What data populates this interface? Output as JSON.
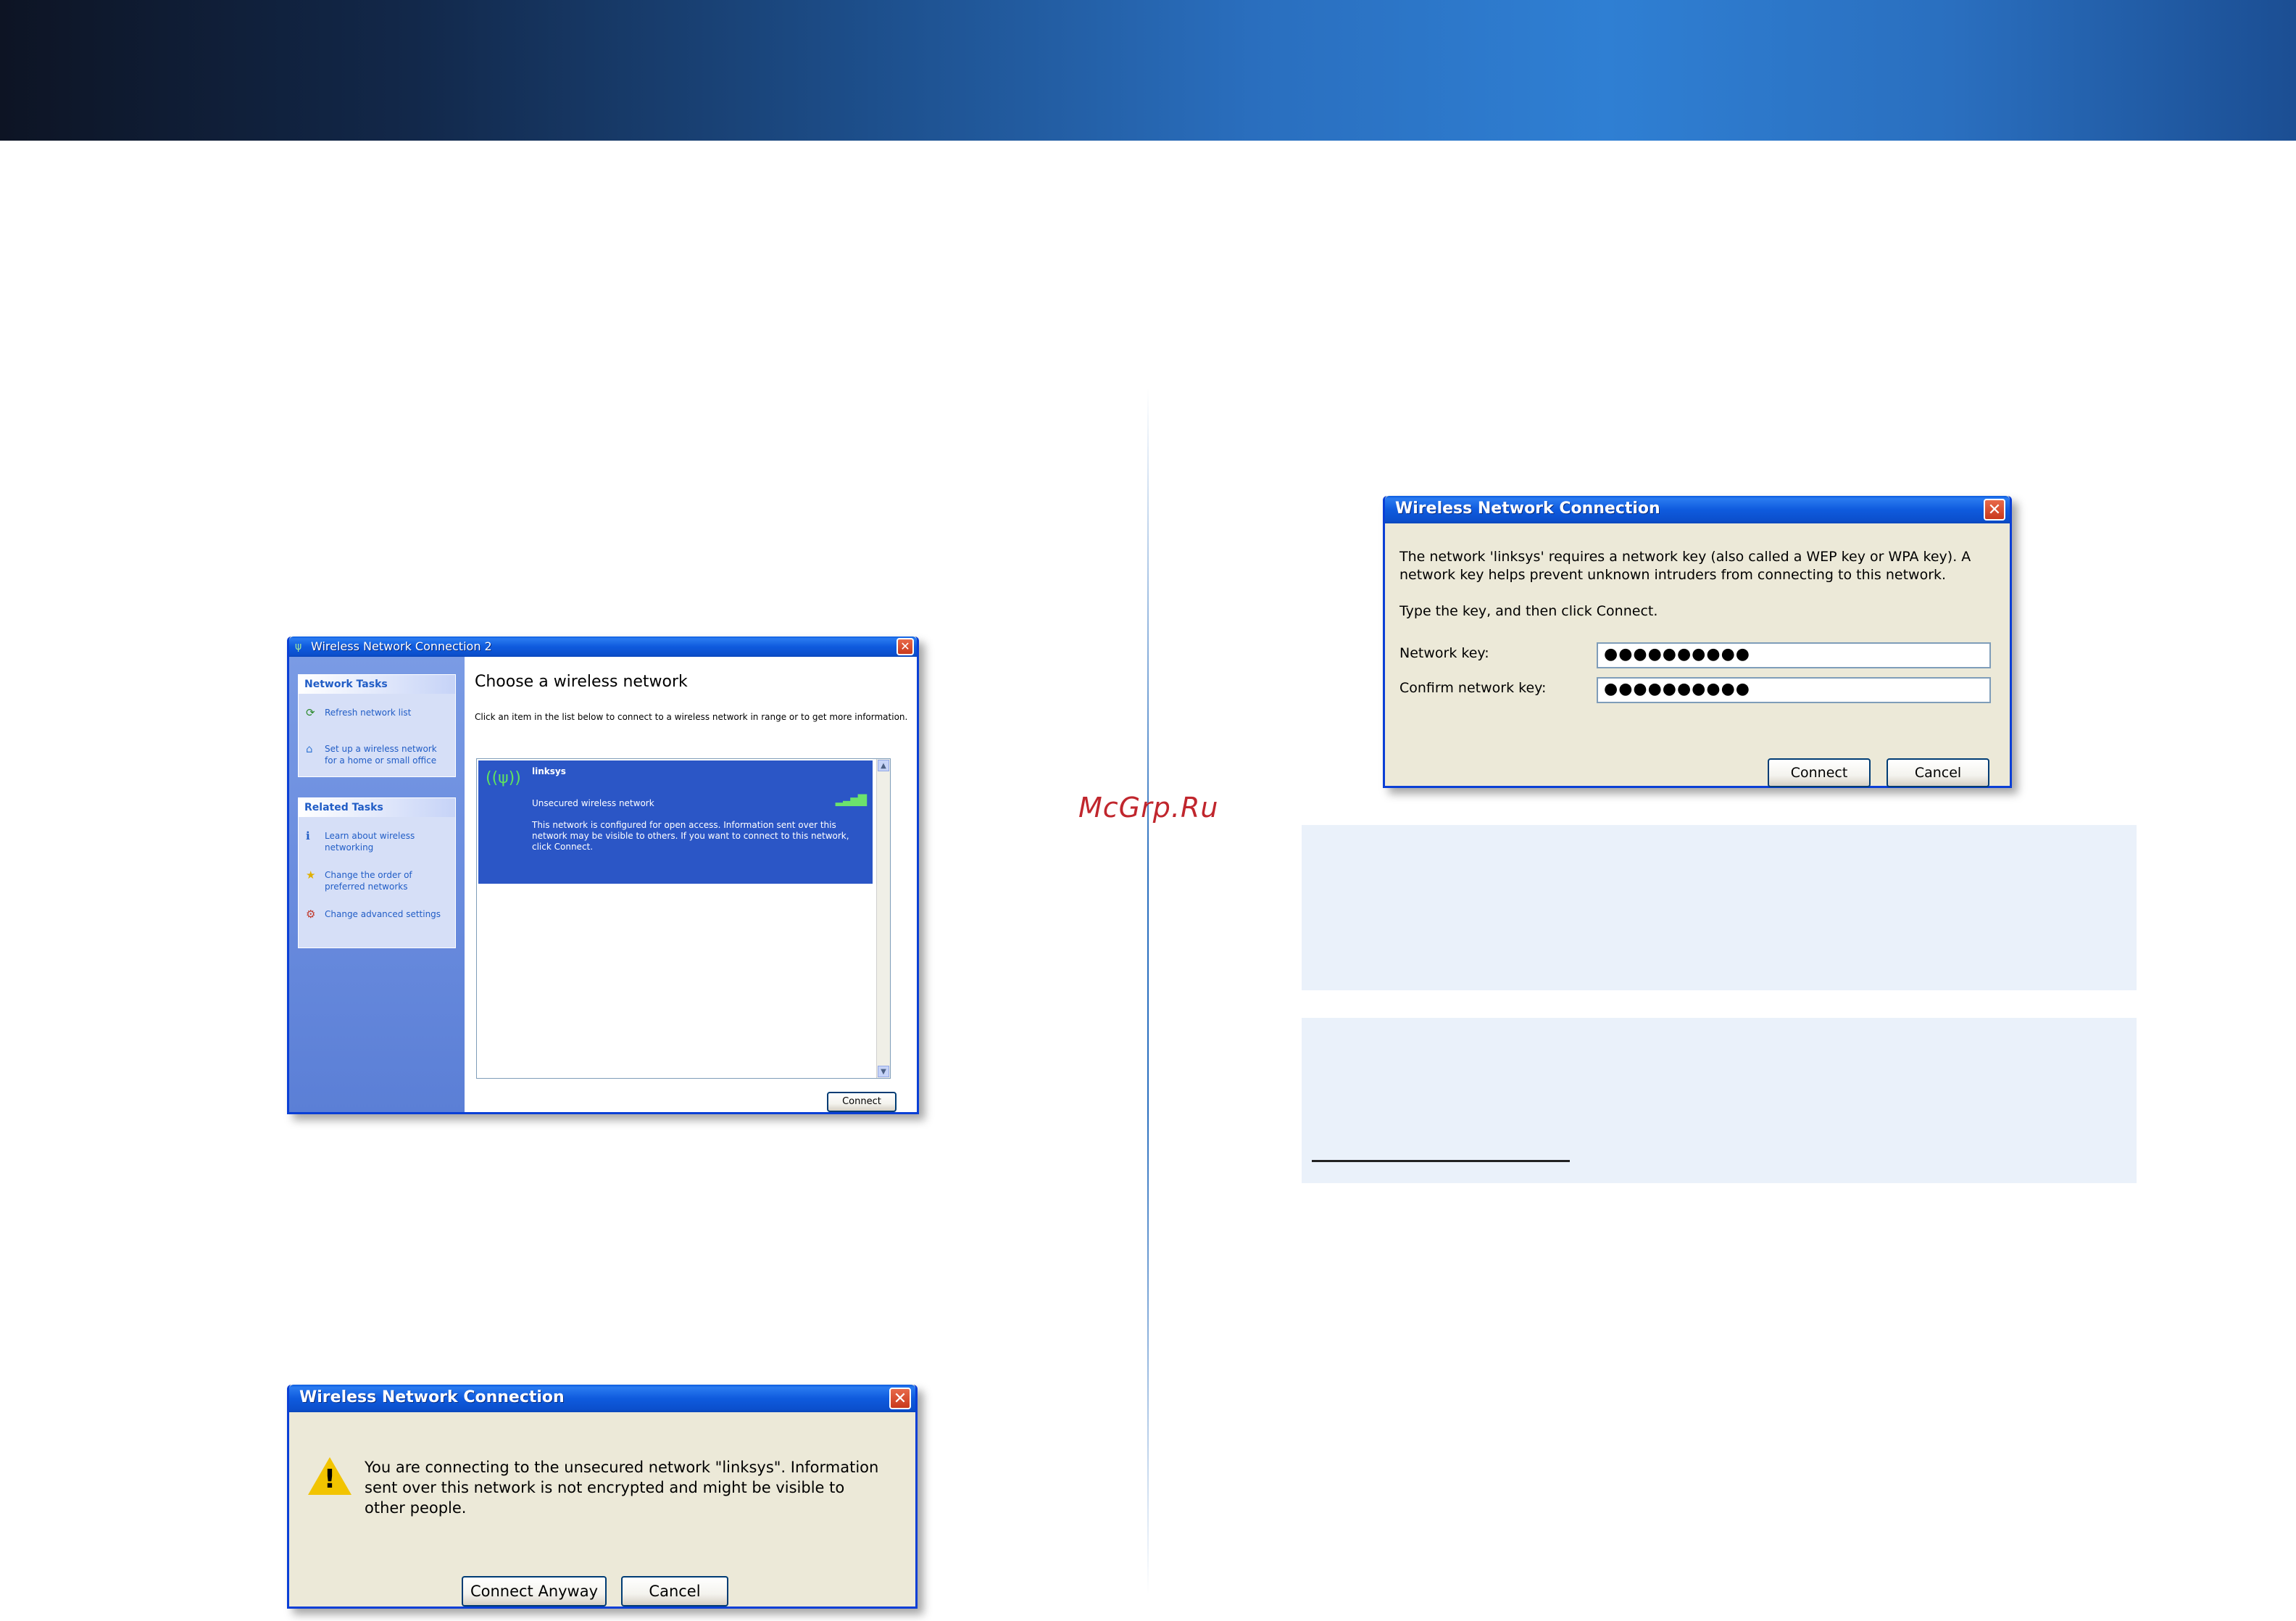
{
  "watermark": "McGrp.Ru",
  "choose_window": {
    "title": "Wireless Network Connection 2",
    "network_tasks_header": "Network Tasks",
    "network_tasks": [
      "Refresh network list",
      "Set up a wireless network for a home or small office"
    ],
    "related_tasks_header": "Related Tasks",
    "related_tasks": [
      "Learn about wireless networking",
      "Change the order of preferred networks",
      "Change advanced settings"
    ],
    "heading": "Choose a wireless network",
    "description": "Click an item in the list below to connect to a wireless network in range or to get more information.",
    "network": {
      "name": "linksys",
      "status": "Unsecured wireless network",
      "info": "This network is configured for open access. Information sent over this network may be visible to others. If you want to connect to this network, click Connect."
    },
    "connect_label": "Connect"
  },
  "unsecured_window": {
    "title": "Wireless Network Connection",
    "message": "You are connecting to the unsecured network \"linksys\". Information sent over this network is not encrypted and might be visible to other people.",
    "connect_anyway_label": "Connect Anyway",
    "cancel_label": "Cancel"
  },
  "key_window": {
    "title": "Wireless Network Connection",
    "message": "The network 'linksys' requires a network key (also called a WEP key or WPA key). A network key helps prevent unknown intruders from connecting to this network.",
    "instruction": "Type the key, and then click Connect.",
    "network_key_label": "Network key:",
    "network_key_value": "●●●●●●●●●●",
    "confirm_key_label": "Confirm network key:",
    "confirm_key_value": "●●●●●●●●●●",
    "connect_label": "Connect",
    "cancel_label": "Cancel"
  },
  "colors": {
    "xp_title_blue": "#0b4fcc",
    "xp_close_red": "#c9391c",
    "selection_blue": "#2b56c6",
    "info_box_bg": "#eaf1fa"
  }
}
